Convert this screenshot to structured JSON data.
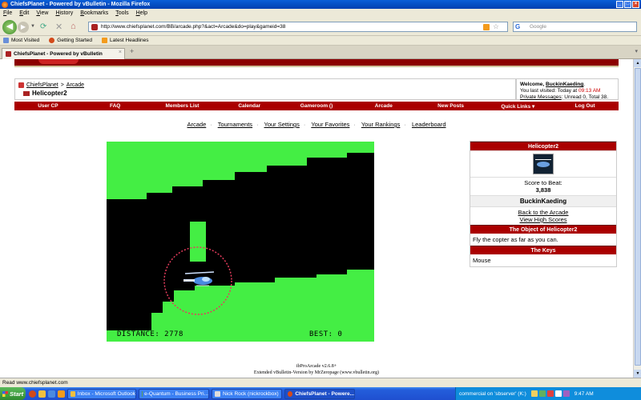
{
  "window": {
    "title": "ChiefsPlanet - Powered by vBulletin - Mozilla Firefox"
  },
  "menu": [
    "File",
    "Edit",
    "View",
    "History",
    "Bookmarks",
    "Tools",
    "Help"
  ],
  "address": {
    "url": "http://www.chiefsplanet.com/BB/arcade.php?&act=Arcade&do=play&gameid=38"
  },
  "search": {
    "placeholder": "Google"
  },
  "bookmarks": [
    "Most Visited",
    "Getting Started",
    "Latest Headlines"
  ],
  "tab": {
    "title": "ChiefsPlanet - Powered by vBulletin"
  },
  "breadcrumb": {
    "root": "ChiefsPlanet",
    "sep": ">",
    "section": "Arcade",
    "title": "Helicopter2"
  },
  "user": {
    "welcome": "Welcome,",
    "name": "BuckinKaeding",
    "last_visited_label": "You last visited: Today at",
    "last_visited_time": "09:13 AM",
    "pm_label": "Private Messages",
    "pm_counts": ": Unread 0, Total 38."
  },
  "mainnav": [
    "User CP",
    "FAQ",
    "Members List",
    "Calendar",
    "Gameroom ()",
    "Arcade",
    "New Posts",
    "Quick Links ▾",
    "Log Out"
  ],
  "arcadenav": [
    "Arcade",
    "Tournaments",
    "Your Settings",
    "Your Favorites",
    "Your Rankings",
    "Leaderboard"
  ],
  "game": {
    "distance_label": "DISTANCE: 2778",
    "best_label": "BEST: 0"
  },
  "side": {
    "game_name": "Helicopter2",
    "score_label": "Score to Beat:",
    "score_value": "3,838",
    "top_player": "BuckinKaeding",
    "link_back": "Back to the Arcade",
    "link_scores": "View High Scores",
    "object_header": "The Object of Helicopter2",
    "object_text": "Fly the copter as far as you can.",
    "keys_header": "The Keys",
    "keys_text": "Mouse"
  },
  "footer": {
    "line1": "ibProArcade v2.6.8+",
    "line2": "Extended vBulletin-Version by MrZeropage (www.vbulletin.org)"
  },
  "status": {
    "text": "Read www.chiefsplanet.com"
  },
  "taskbar": {
    "start": "Start",
    "items": [
      "Inbox - Microsoft Outlook",
      "e-Quantum - Business Pri...",
      "Nick Rock (nickrockbox)",
      "ChiefsPlanet - Powere..."
    ],
    "tray_text": "commercial on 'sbserver' (K:)",
    "clock": "9:47 AM"
  },
  "colors": {
    "cave_green": "#44ee44",
    "forum_red": "#aa0000",
    "start_green": "#3a9a3a"
  }
}
